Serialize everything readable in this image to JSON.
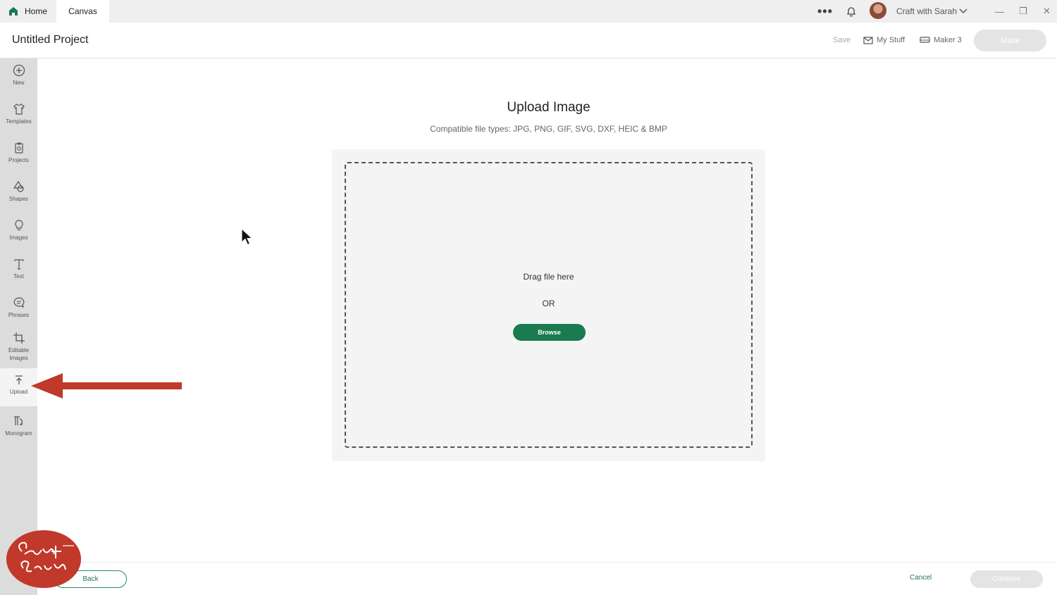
{
  "titlebar": {
    "tabs": [
      {
        "label": "Home"
      },
      {
        "label": "Canvas"
      }
    ],
    "user_name": "Craft with Sarah",
    "more_glyph": "•••",
    "window_controls": {
      "minimize": "—",
      "maximize": "❐",
      "close": "✕"
    }
  },
  "header": {
    "project_title": "Untitled Project",
    "save_label": "Save",
    "my_stuff_label": "My Stuff",
    "machine_label": "Maker 3",
    "make_label": "Make"
  },
  "sidebar": {
    "items": [
      {
        "label": "New",
        "icon": "plus-circle-icon"
      },
      {
        "label": "Templates",
        "icon": "shirt-icon"
      },
      {
        "label": "Projects",
        "icon": "projects-icon"
      },
      {
        "label": "Shapes",
        "icon": "shapes-icon"
      },
      {
        "label": "Images",
        "icon": "lightbulb-icon"
      },
      {
        "label": "Text",
        "icon": "text-icon"
      },
      {
        "label": "Phrases",
        "icon": "speech-bubble-icon"
      },
      {
        "label": "Editable Images",
        "icon": "crop-icon"
      },
      {
        "label": "Upload",
        "icon": "upload-icon"
      },
      {
        "label": "Monogram",
        "icon": "monogram-icon"
      }
    ],
    "active": "Upload"
  },
  "main": {
    "title": "Upload Image",
    "subtitle": "Compatible file types:  JPG, PNG, GIF, SVG, DXF, HEIC & BMP",
    "drag_text": "Drag file here",
    "or_text": "OR",
    "browse_label": "Browse"
  },
  "footer": {
    "back_label": "Back",
    "cancel_label": "Cancel",
    "continue_label": "Continue"
  },
  "colors": {
    "accent_green": "#1a7a50",
    "arrow_red": "#c0392b",
    "sidebar_bg": "#dcdcdc"
  }
}
